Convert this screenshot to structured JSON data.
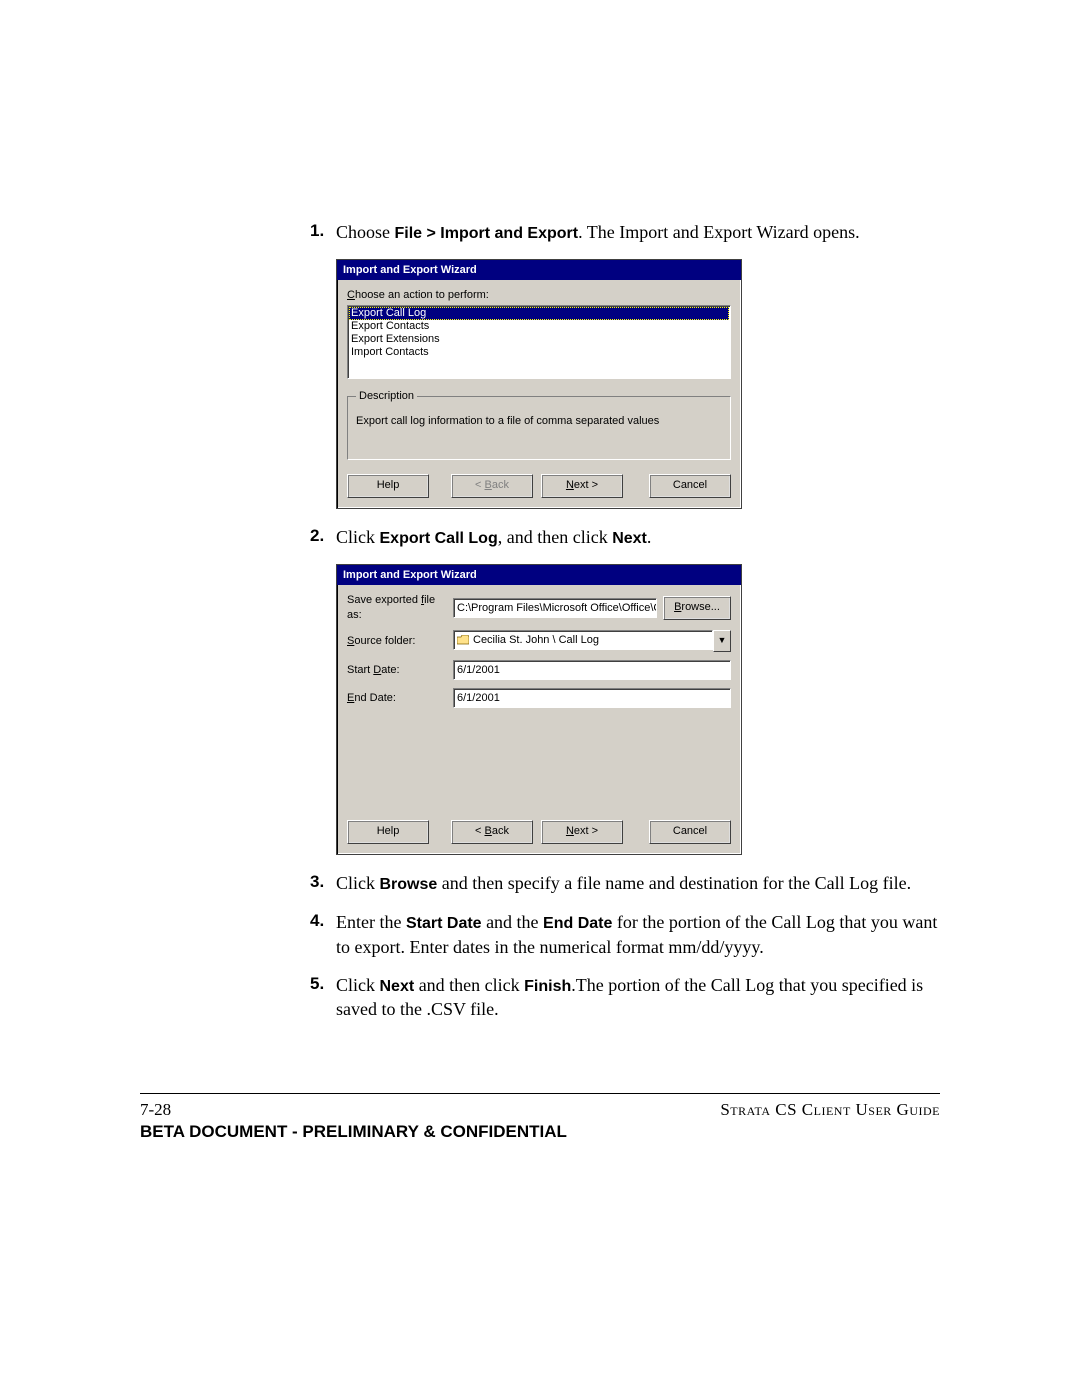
{
  "steps": {
    "s1": {
      "num": "1.",
      "pre": "Choose ",
      "bold1": "File > Import and Export",
      "post": ". The Import and Export Wizard opens."
    },
    "s2": {
      "num": "2.",
      "pre": "Click ",
      "bold1": "Export Call Log",
      "mid": ", and then click ",
      "bold2": "Next",
      "post": "."
    },
    "s3": {
      "num": "3.",
      "pre": "Click ",
      "bold1": "Browse",
      "post": " and then specify a file name and destination for the Call Log file."
    },
    "s4": {
      "num": "4.",
      "pre": "Enter the ",
      "bold1": "Start Date",
      "mid1": " and the ",
      "bold2": "End Date",
      "post": " for the portion of the Call Log that you want to export. Enter dates in the numerical format mm/dd/yyyy."
    },
    "s5": {
      "num": "5.",
      "pre": "Click ",
      "bold1": "Next",
      "mid1": " and then click ",
      "bold2": "Finish",
      "post": ".The portion of the Call Log that you specified is saved to the .CSV file."
    }
  },
  "dlg1": {
    "title": "Import and Export Wizard",
    "choose_pre": "C",
    "choose_post": "hoose an action to perform:",
    "items": {
      "0": "Export Call Log",
      "1": "Export Contacts",
      "2": "Export Extensions",
      "3": "Import Contacts"
    },
    "group_legend": "Description",
    "desc": "Export call log information to a file of comma separated values",
    "help": "Help",
    "back_pre": "< ",
    "back_u": "B",
    "back_post": "ack",
    "next_u": "N",
    "next_post": "ext >",
    "cancel": "Cancel"
  },
  "dlg2": {
    "title": "Import and Export Wizard",
    "save_label_pre": "Save exported ",
    "save_label_u": "f",
    "save_label_post": "ile as:",
    "save_value": "C:\\Program Files\\Microsoft Office\\Office\\Call",
    "browse_u": "B",
    "browse_post": "rowse...",
    "src_label_u": "S",
    "src_label_post": "ource folder:",
    "src_value": "Cecilia St. John \\ Call Log",
    "start_label_pre": "Start ",
    "start_label_u": "D",
    "start_label_post": "ate:",
    "start_value": "6/1/2001",
    "end_label_u": "E",
    "end_label_post": "nd Date:",
    "end_value": "6/1/2001",
    "help": "Help",
    "back_pre": "< ",
    "back_u": "B",
    "back_post": "ack",
    "next_u": "N",
    "next_post": "ext >",
    "cancel": "Cancel"
  },
  "footer": {
    "page": "7-28",
    "guide": "Strata CS Client User Guide",
    "confidential": "BETA DOCUMENT - PRELIMINARY & CONFIDENTIAL"
  }
}
